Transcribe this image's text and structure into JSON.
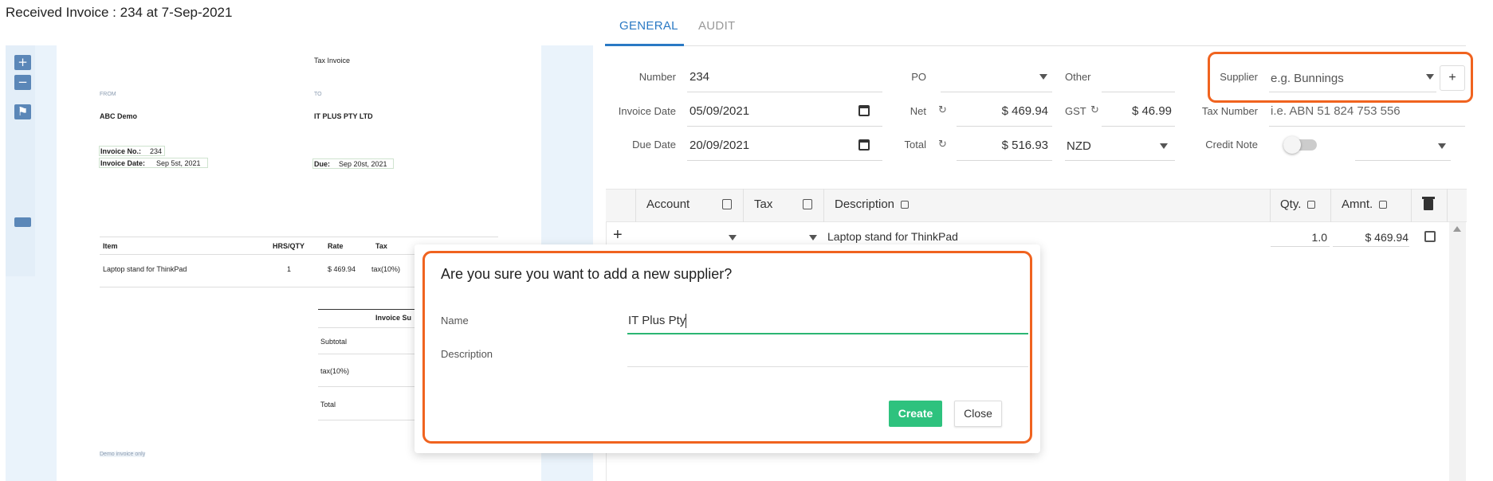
{
  "page": {
    "title": "Received Invoice : 234 at 7-Sep-2021"
  },
  "preview": {
    "zoom_in": "+",
    "zoom_out": "−",
    "flag": "⚑",
    "doc_title": "Tax Invoice",
    "from_label": "FROM",
    "from_name": "ABC Demo",
    "to_label": "TO",
    "to_name": "IT PLUS PTY LTD",
    "invoice_no_label": "Invoice No.:",
    "invoice_no": "234",
    "invoice_date_label": "Invoice Date:",
    "invoice_date": "Sep 5st, 2021",
    "due_label": "Due:",
    "due_date": "Sep 20st, 2021",
    "table_headers": [
      "Item",
      "HRS/QTY",
      "Rate",
      "Tax"
    ],
    "table_row": [
      "Laptop stand for ThinkPad",
      "1",
      "$ 469.94",
      "tax(10%)"
    ],
    "summary_header": "Invoice Su",
    "summary_rows": [
      "Subtotal",
      "tax(10%)",
      "Total"
    ],
    "footer": "Demo invoice only"
  },
  "tabs": [
    {
      "label": "GENERAL",
      "active": true
    },
    {
      "label": "AUDIT",
      "active": false
    }
  ],
  "form": {
    "number_label": "Number",
    "number_value": "234",
    "po_label": "PO",
    "other_label": "Other",
    "supplier_label": "Supplier",
    "supplier_placeholder": "e.g. Bunnings",
    "supplier_add": "+",
    "invoice_date_label": "Invoice Date",
    "invoice_date_value": "05/09/2021",
    "net_label": "Net",
    "net_value": "$ 469.94",
    "gst_label": "GST",
    "gst_value": "$ 46.99",
    "tax_number_label": "Tax Number",
    "tax_number_placeholder": "i.e. ABN 51 824 753 556",
    "due_date_label": "Due Date",
    "due_date_value": "20/09/2021",
    "total_label": "Total",
    "total_value": "$ 516.93",
    "currency_value": "NZD",
    "credit_note_label": "Credit Note",
    "credit_note_on": false,
    "recalc_icon": "↻"
  },
  "grid": {
    "headers": [
      "Account",
      "Tax",
      "Description",
      "Qty.",
      "Amnt."
    ],
    "row_add": "+",
    "row": {
      "description": "Laptop stand for ThinkPad",
      "qty": "1.0",
      "amount": "$ 469.94"
    }
  },
  "dialog": {
    "title": "Are you sure you want to add a new supplier?",
    "name_label": "Name",
    "name_value": "IT Plus Pty",
    "description_label": "Description",
    "create_label": "Create",
    "close_label": "Close"
  },
  "colors": {
    "accent": "#2a79c4",
    "highlight": "#f0631f",
    "create": "#2ec27e",
    "preview_btn": "#5b87b8"
  }
}
